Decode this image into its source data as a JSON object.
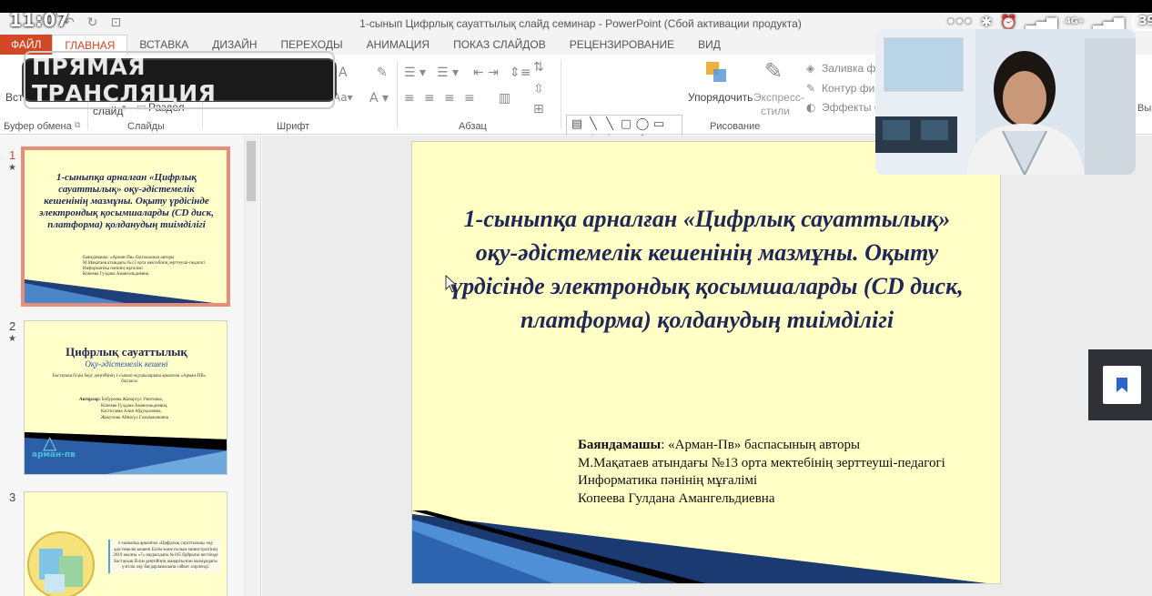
{
  "phone": {
    "time": "11:07",
    "network": "4G+",
    "battery": "39"
  },
  "window": {
    "title": "1-сынып Цифрлық сауаттылық слайд семинар - PowerPoint (Сбой активации продукта)"
  },
  "ribbon_tabs": [
    "ФАЙЛ",
    "ГЛАВНАЯ",
    "ВСТАВКА",
    "ДИЗАЙН",
    "ПЕРЕХОДЫ",
    "АНИМАЦИЯ",
    "ПОКАЗ СЛАЙДОВ",
    "РЕЦЕНЗИРОВАНИЕ",
    "ВИД"
  ],
  "active_tab": "ГЛАВНАЯ",
  "live_badge": "ПРЯМАЯ ТРАНСЛЯЦИЯ",
  "ribbon": {
    "paste_label": "Вст",
    "slide_label": "слайд",
    "section_label": "Раздел",
    "arrange_label": "Упорядочить",
    "quick_styles_label": "Экспресс-",
    "quick_styles_label2": "стили",
    "fill_label": "Заливка фи",
    "outline_label": "Контур фи",
    "effects_label": "Эффекты ф",
    "vx_label": "Вы"
  },
  "ribbon_groups": {
    "clipboard": "Буфер обмена",
    "slides": "Слайды",
    "font": "Шрифт",
    "paragraph": "Абзац",
    "drawing": "Рисование"
  },
  "shapes_palette": [
    "▤",
    "╲",
    "╲",
    "▢",
    "◯",
    "▭",
    "△",
    "↰",
    "↰",
    "⇨",
    "⇩",
    "⟳",
    "△",
    "╮",
    "╮",
    "{",
    "}",
    "☆"
  ],
  "slides_pane": [
    {
      "number": "1",
      "title": "1-сыныпқа арналған «Цифрлық сауаттылық» оқу-әдістемелік кешенінің мазмұны. Оқыту үрдісінде электрондық қосымшаларды (CD диск, платформа) қолданудың тиімділігі",
      "info": [
        "Баяндамашы: «Арман-Пв» баспасының авторы",
        "М.Мақатаев атындағы №13 орта мектебінің зерттеуші-педагогі",
        "Информатика пәнінің мұғалімі",
        "Копеева Гулдана Амангельдиевна"
      ]
    },
    {
      "number": "2",
      "title": "Цифрлық сауаттылық",
      "subtitle": "Оқу-әдістемелік кешені",
      "text": "Бастауыш білім беру деңгейінің 1-сынып оқушыларына арналған «Арман-ПВ» баспасы",
      "authors_label": "Авторлар:",
      "authors": [
        "Бобуреева Жанаргүл Умитовна,",
        "Копеева Гулдана Амангельдиевна,",
        "Кастигаева Алия Абдуқызовна,",
        "Жакупова Айнагүл Галымжановна"
      ],
      "logo": "арман-пв"
    },
    {
      "number": "3",
      "text": "1-сыныпқа арналған «Цифрлық сауаттылық» оқу әдістемелік кешені Білім және ғылым министрлігінің 2019 жылғы «7» наурыздағы №105 бұйрығы негізінде Бастауыш білім деңгейінің жаңартылған мазмұндағы үлгілік оқу бағдарламасына сәйкес әзірленді."
    }
  ],
  "current_slide": {
    "title": "1-сыныпқа арналған «Цифрлық сауаттылық» оқу-әдістемелік кешенінің мазмұны. Оқыту үрдісінде электрондық қосымшаларды (CD диск, платформа) қолданудың тиімділігі",
    "info_label": "Баяндамашы",
    "info_line1_rest": ": «Арман-Пв» баспасының авторы",
    "info_line2": "М.Мақатаев атындағы №13 орта мектебінің зерттеуші-педагогі",
    "info_line3": "Информатика пәнінің мұғалімі",
    "info_line4": "Копеева Гулдана Амангельдиевна"
  }
}
